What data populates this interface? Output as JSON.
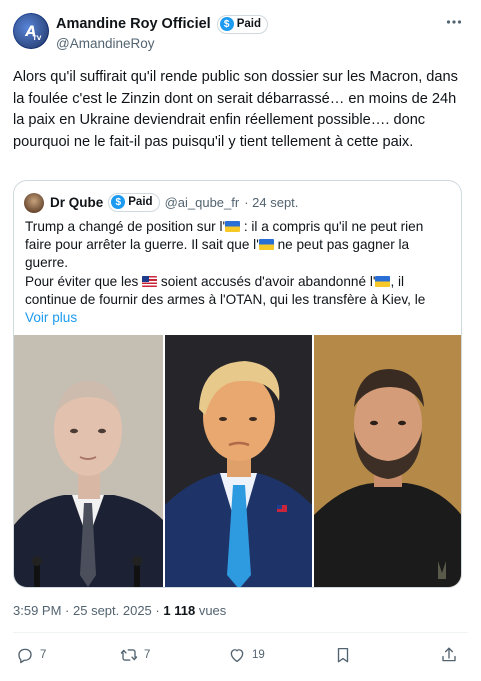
{
  "author": {
    "display_name": "Amandine Roy Officiel",
    "handle": "@AmandineRoy",
    "badge": "Paid",
    "avatar_letters": "ATV",
    "avatar_color": "#1f4fb0"
  },
  "tweet": {
    "text": "Alors qu'il suffirait qu'il rende public son dossier sur les Macron, dans la foulée c'est le Zinzin dont on serait débarrassé… en moins de 24h la paix en Ukraine deviendrait enfin réellement possible…. donc pourquoi ne le fait-il pas puisqu'il y tient tellement à  cette paix.",
    "time": "3:59 PM",
    "date": "25 sept. 2025",
    "views_count": "1 118",
    "views_label": "vues"
  },
  "quote": {
    "display_name": "Dr Qube",
    "badge": "Paid",
    "handle": "@ai_qube_fr",
    "date": "· 24 sept.",
    "p1_a": "Trump a changé de position sur l'",
    "p1_b": " : il a compris qu'il ne peut rien faire pour arrêter la guerre. Il sait que l'",
    "p1_c": " ne peut pas gagner la guerre.",
    "p2_a": "Pour éviter que les ",
    "p2_b": " soient accusés d'avoir abandonné l'",
    "p2_c": ", il continue de fournir des armes à l'OTAN, qui les transfère à Kiev, le",
    "read_more": "Voir plus"
  },
  "actions": {
    "replies": "7",
    "reposts": "7",
    "likes": "19"
  },
  "colors": {
    "accent": "#1d9bf0",
    "text": "#0f1419",
    "secondary": "#536471",
    "border": "#cfd9de"
  }
}
